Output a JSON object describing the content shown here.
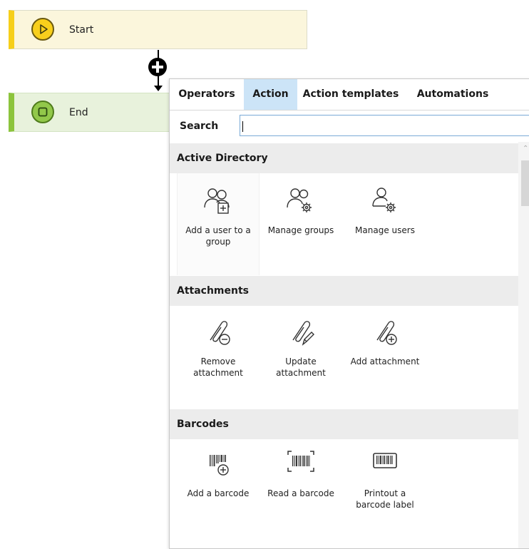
{
  "workflow": {
    "start_label": "Start",
    "end_label": "End"
  },
  "panel": {
    "tabs": [
      {
        "label": "Operators"
      },
      {
        "label": "Action"
      },
      {
        "label": "Action templates"
      },
      {
        "label": "Automations"
      }
    ],
    "active_tab": "Action",
    "search": {
      "label": "Search",
      "value": "",
      "placeholder": ""
    },
    "sections": [
      {
        "title": "Active Directory",
        "items": [
          {
            "label": "Add a user to a group",
            "icon": "add-user-to-group-icon"
          },
          {
            "label": "Manage groups",
            "icon": "manage-groups-icon"
          },
          {
            "label": "Manage users",
            "icon": "manage-users-icon"
          }
        ]
      },
      {
        "title": "Attachments",
        "items": [
          {
            "label": "Remove attachment",
            "icon": "remove-attachment-icon"
          },
          {
            "label": "Update attachment",
            "icon": "update-attachment-icon"
          },
          {
            "label": "Add attachment",
            "icon": "add-attachment-icon"
          }
        ]
      },
      {
        "title": "Barcodes",
        "items": [
          {
            "label": "Add a barcode",
            "icon": "add-barcode-icon"
          },
          {
            "label": "Read a barcode",
            "icon": "read-barcode-icon"
          },
          {
            "label": "Printout a barcode label",
            "icon": "print-barcode-label-icon"
          }
        ]
      }
    ]
  }
}
